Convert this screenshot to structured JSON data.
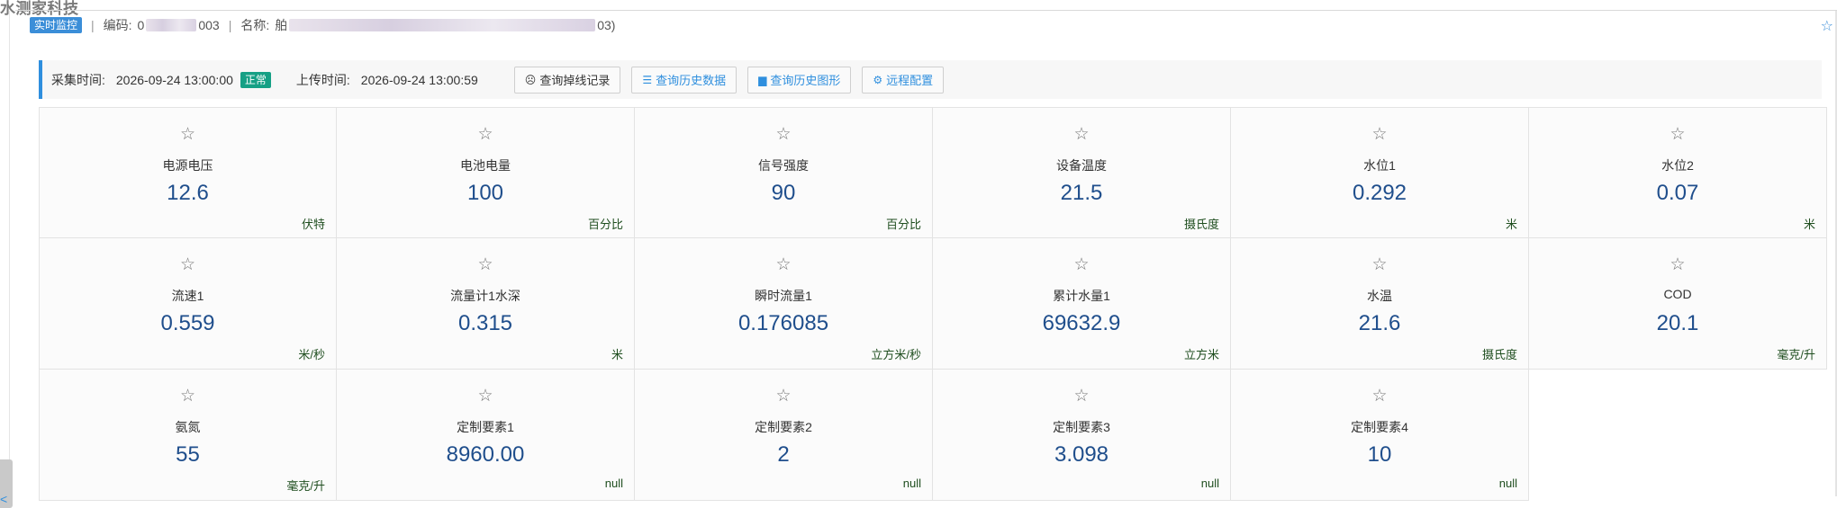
{
  "brand": "水测家科技",
  "header": {
    "live_badge": "实时监控",
    "code_label": "编码:",
    "code_prefix": "0",
    "code_suffix": "003",
    "name_label": "名称:",
    "name_prefix": "舶",
    "name_suffix": "03)"
  },
  "infobar": {
    "collect_label": "采集时间:",
    "collect_time": "2026-09-24 13:00:00",
    "status": "正常",
    "upload_label": "上传时间:",
    "upload_time": "2026-09-24 13:00:59",
    "buttons": [
      "查询掉线记录",
      "查询历史数据",
      "查询历史图形",
      "远程配置"
    ]
  },
  "metrics": [
    {
      "name": "电源电压",
      "value": "12.6",
      "unit": "伏特"
    },
    {
      "name": "电池电量",
      "value": "100",
      "unit": "百分比"
    },
    {
      "name": "信号强度",
      "value": "90",
      "unit": "百分比"
    },
    {
      "name": "设备温度",
      "value": "21.5",
      "unit": "摄氏度"
    },
    {
      "name": "水位1",
      "value": "0.292",
      "unit": "米"
    },
    {
      "name": "水位2",
      "value": "0.07",
      "unit": "米"
    },
    {
      "name": "流速1",
      "value": "0.559",
      "unit": "米/秒"
    },
    {
      "name": "流量计1水深",
      "value": "0.315",
      "unit": "米"
    },
    {
      "name": "瞬时流量1",
      "value": "0.176085",
      "unit": "立方米/秒"
    },
    {
      "name": "累计水量1",
      "value": "69632.9",
      "unit": "立方米"
    },
    {
      "name": "水温",
      "value": "21.6",
      "unit": "摄氏度"
    },
    {
      "name": "COD",
      "value": "20.1",
      "unit": "毫克/升"
    },
    {
      "name": "氨氮",
      "value": "55",
      "unit": "毫克/升"
    },
    {
      "name": "定制要素1",
      "value": "8960.00",
      "unit": "null"
    },
    {
      "name": "定制要素2",
      "value": "2",
      "unit": "null"
    },
    {
      "name": "定制要素3",
      "value": "3.098",
      "unit": "null"
    },
    {
      "name": "定制要素4",
      "value": "10",
      "unit": "null"
    }
  ]
}
